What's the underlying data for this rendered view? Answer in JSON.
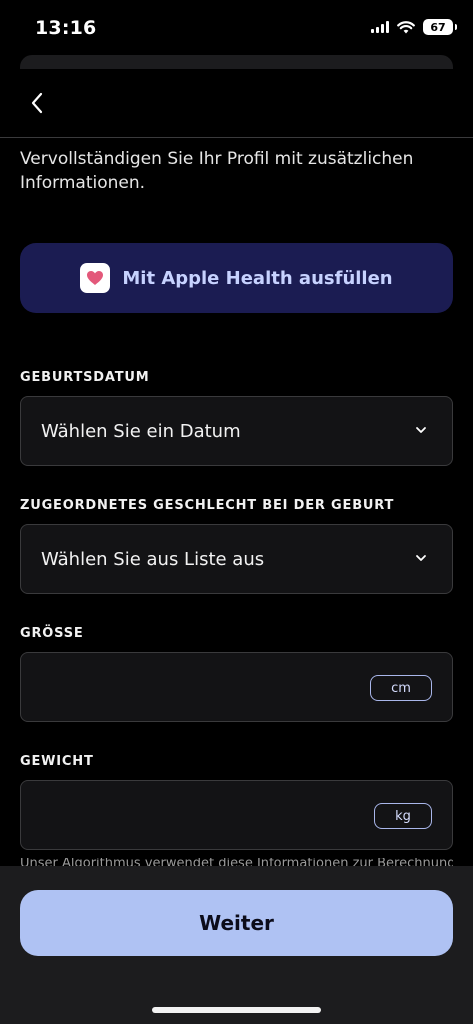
{
  "status_bar": {
    "time": "13:16",
    "battery": "67",
    "icons": [
      "cellular-signal-icon",
      "wifi-icon",
      "battery-icon"
    ]
  },
  "nav": {
    "back_icon": "chevron-left-icon"
  },
  "intro": {
    "text": "Vervollständigen Sie Ihr Profil mit zusätzlichen Informationen."
  },
  "health_button": {
    "icon": "apple-health-heart-icon",
    "label": "Mit Apple Health ausfüllen"
  },
  "fields": {
    "birthdate": {
      "label": "GEBURTSDATUM",
      "value": "Wählen Sie ein Datum"
    },
    "sex": {
      "label": "ZUGEORDNETES GESCHLECHT BEI DER GEBURT",
      "value": "Wählen Sie aus Liste aus"
    },
    "height": {
      "label": "GRÖSSE",
      "value": "",
      "unit": "cm"
    },
    "weight": {
      "label": "GEWICHT",
      "value": "",
      "unit": "kg"
    }
  },
  "footer_note": {
    "text": "Unser Algorithmus verwendet diese Informationen zur Berechnung"
  },
  "continue_button": {
    "label": "Weiter"
  },
  "colors": {
    "background": "#000000",
    "health_button_bg": "#1b1c52",
    "health_button_text": "#c7d2ff",
    "primary_button_bg": "#afc2f3",
    "heart": "#e3587a"
  }
}
